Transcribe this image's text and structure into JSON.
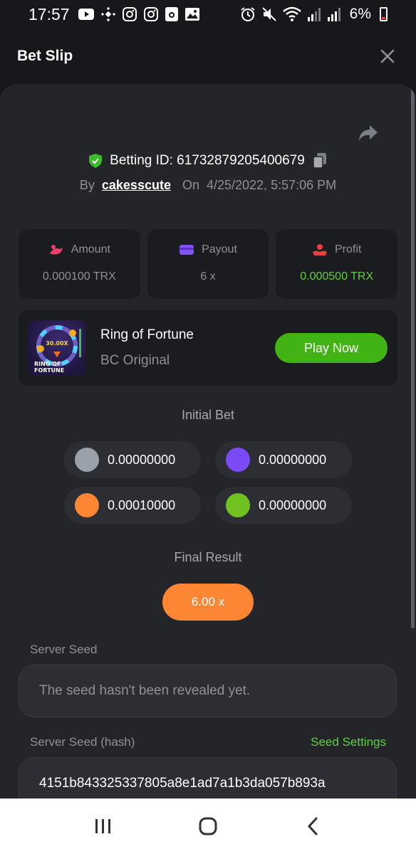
{
  "status_bar": {
    "time": "17:57",
    "battery": "6%",
    "left_icons": [
      "youtube-icon",
      "binance-icon",
      "instagram-icon",
      "instagram-icon",
      "camera-icon",
      "gallery-icon"
    ],
    "right_icons": [
      "alarm-icon",
      "mute-icon",
      "wifi-icon",
      "signal-icon",
      "signal-icon",
      "battery-icon"
    ]
  },
  "header": {
    "title": "Bet Slip"
  },
  "bet": {
    "id_text": "Betting ID: 61732879205400679",
    "by_label": "By",
    "user": "cakesscute",
    "on_label": "On",
    "date": "4/25/2022, 5:57:06 PM"
  },
  "stats": {
    "amount": {
      "label": "Amount",
      "value": "0.000100 TRX"
    },
    "payout": {
      "label": "Payout",
      "value": "6 x"
    },
    "profit": {
      "label": "Profit",
      "value": "0.000500 TRX"
    }
  },
  "game": {
    "name": "Ring of Fortune",
    "subtitle": "BC Original",
    "play_label": "Play Now",
    "thumb_multiplier": "30.00X",
    "thumb_title_1": "RING OF",
    "thumb_title_2": "FORTUNE"
  },
  "initial_bet": {
    "title": "Initial Bet",
    "chips": [
      {
        "value": "0.00000000",
        "color": "#9ba1aa"
      },
      {
        "value": "0.00000000",
        "color": "#7a4bf5"
      },
      {
        "value": "0.00010000",
        "color": "#fd8634"
      },
      {
        "value": "0.00000000",
        "color": "#6fc21f"
      }
    ]
  },
  "final_result": {
    "title": "Final Result",
    "value": "6.00 x"
  },
  "server_seed": {
    "label": "Server Seed",
    "value": "The seed hasn't been revealed yet."
  },
  "server_seed_hash": {
    "label": "Server Seed (hash)",
    "settings_label": "Seed Settings",
    "value": "4151b843325337805a8e1ad7a1b3da057b893a"
  },
  "colors": {
    "accent_green": "#5ed13d",
    "play_button": "#41b314",
    "result_orange": "#fd8634",
    "panel_bg": "#232529",
    "card_bg": "#1b1c1f"
  }
}
